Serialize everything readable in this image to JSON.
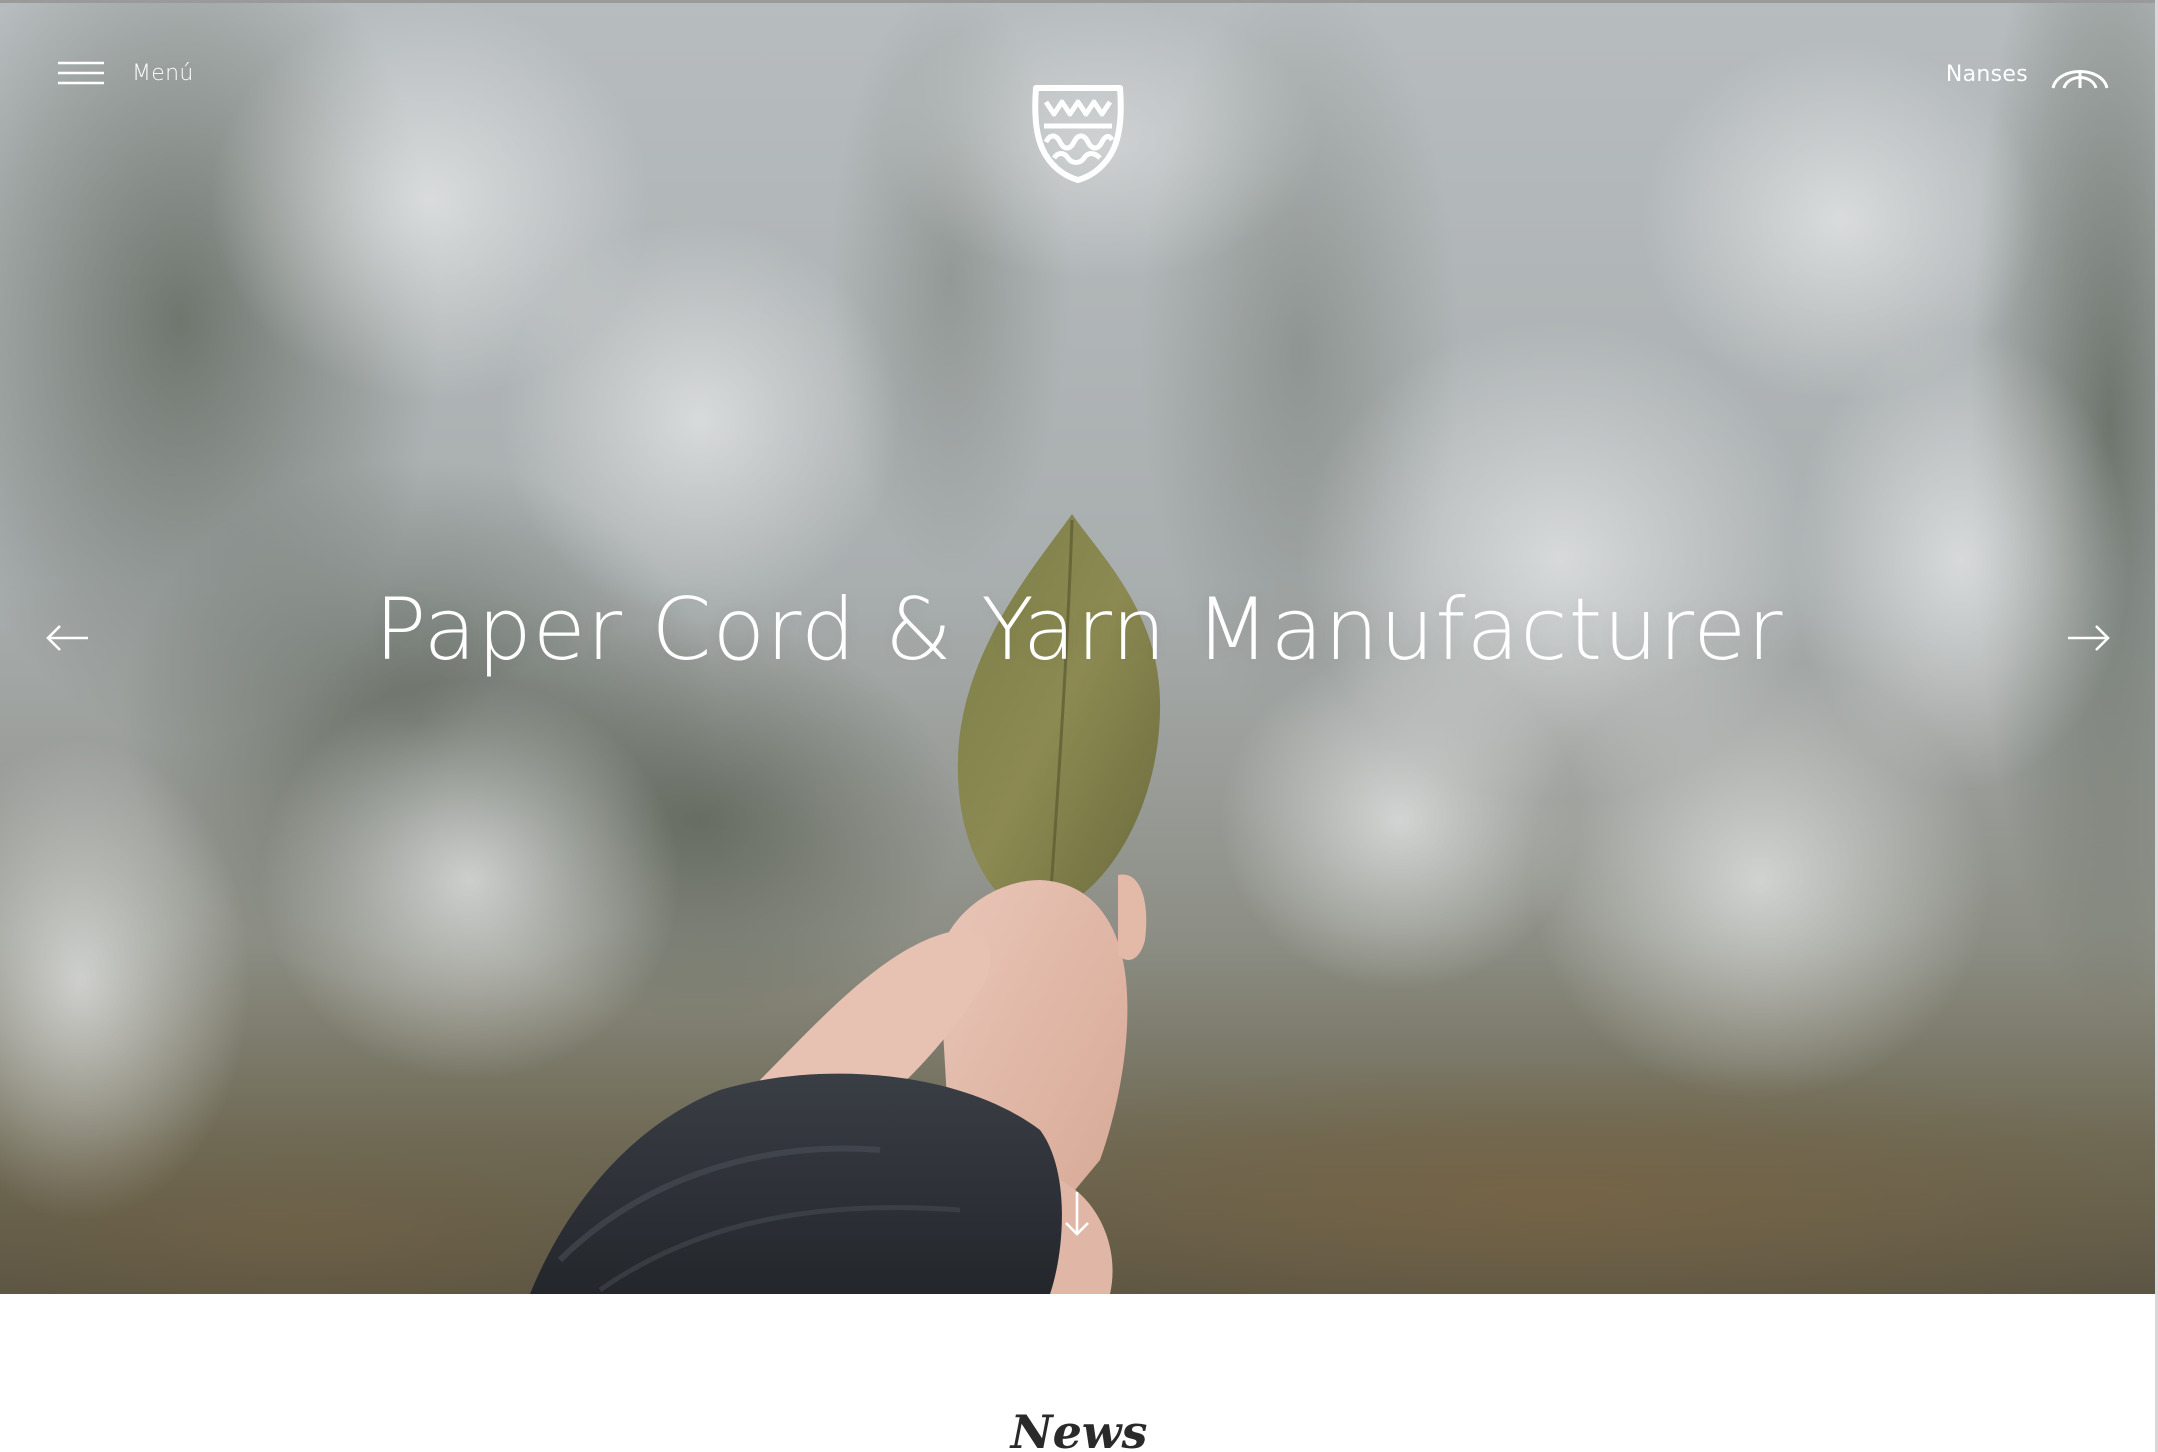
{
  "header": {
    "menu_label": "Menú",
    "account_label": "Nanses",
    "icons": {
      "menu": "hamburger-icon",
      "logo": "crest-logo",
      "account": "arch-icon"
    }
  },
  "hero": {
    "title": "Paper Cord & Yarn Manufacturer",
    "prev_icon": "arrow-left-icon",
    "next_icon": "arrow-right-icon",
    "scroll_icon": "arrow-down-icon"
  },
  "news": {
    "heading": "News"
  },
  "colors": {
    "overlay_text": "#ffffff",
    "news_heading": "#2a2a2a",
    "page_background": "#ffffff"
  }
}
